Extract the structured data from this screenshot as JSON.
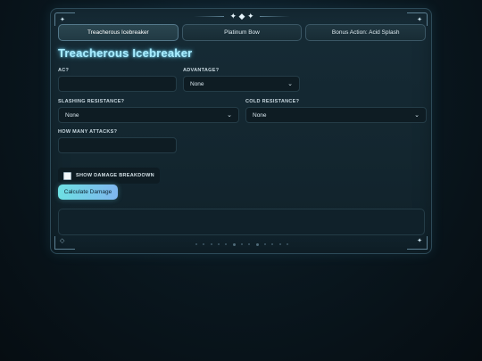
{
  "ornament": {
    "top_glyph": "✦ ◆ ✦"
  },
  "tabs": [
    {
      "label": "Treacherous Icebreaker",
      "active": true
    },
    {
      "label": "Platinum Bow",
      "active": false
    },
    {
      "label": "Bonus Action: Acid Splash",
      "active": false
    }
  ],
  "page": {
    "title": "Treacherous Icebreaker"
  },
  "form": {
    "ac": {
      "label": "AC?",
      "value": ""
    },
    "advantage": {
      "label": "ADVANTAGE?",
      "value": "None"
    },
    "slashing_resistance": {
      "label": "SLASHING RESISTANCE?",
      "value": "None"
    },
    "cold_resistance": {
      "label": "COLD RESISTANCE?",
      "value": "None"
    },
    "attacks": {
      "label": "HOW MANY ATTACKS?",
      "value": ""
    },
    "breakdown": {
      "label": "SHOW DAMAGE BREAKDOWN",
      "checked": false
    },
    "calculate_label": "Calculate Damage"
  },
  "output": {
    "text": ""
  },
  "colors": {
    "accent_title": "#a8ecff",
    "button_start": "#6ee0e3",
    "button_end": "#7fb6ef",
    "panel_border": "#2d4a58"
  }
}
